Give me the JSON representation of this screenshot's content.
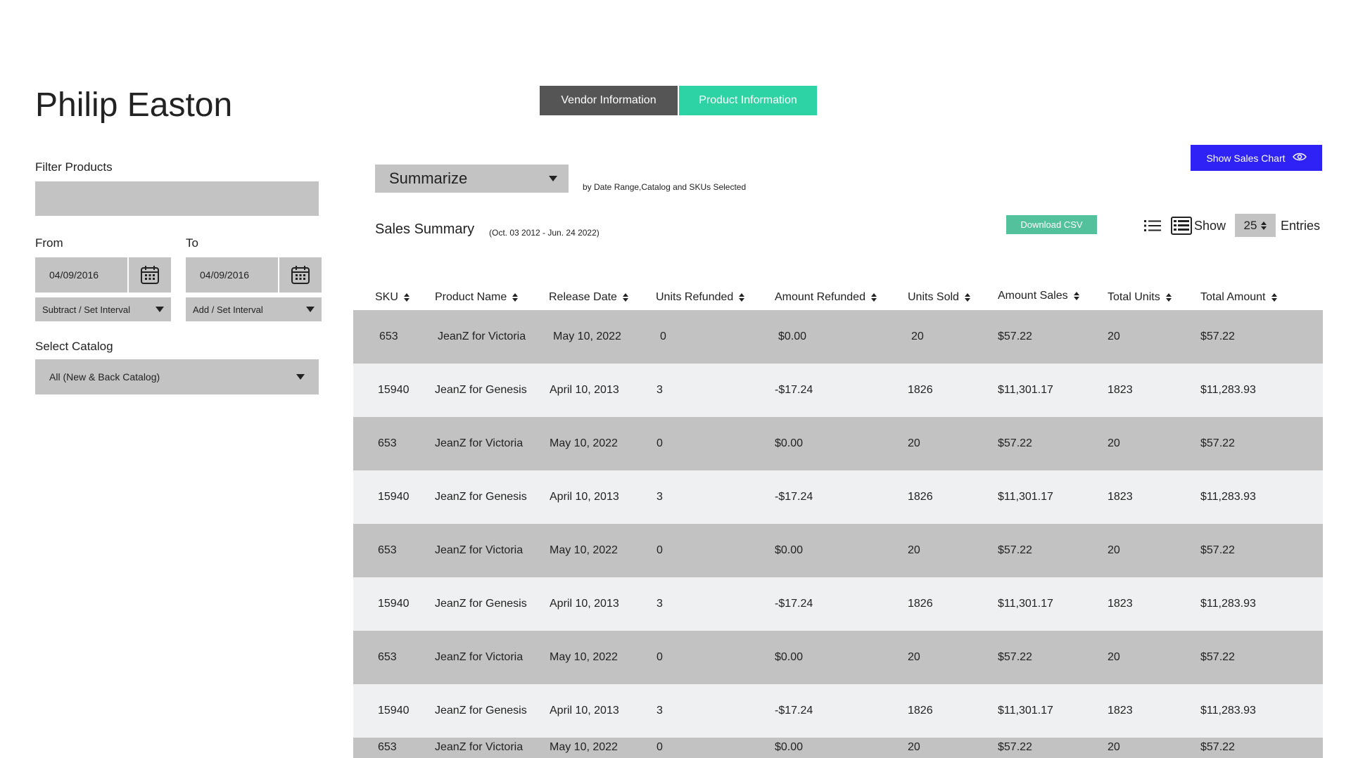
{
  "vendor": {
    "name": "Philip Easton"
  },
  "tabs": [
    {
      "label": "Vendor Information",
      "active": false
    },
    {
      "label": "Product Information",
      "active": true
    }
  ],
  "filter": {
    "label": "Filter Products",
    "value": ""
  },
  "date_range": {
    "from_label": "From",
    "to_label": "To",
    "from_value": "04/09/2016",
    "to_value": "04/09/2016",
    "from_interval": "Subtract / Set Interval",
    "to_interval": "Add / Set Interval"
  },
  "catalog": {
    "label": "Select Catalog",
    "selected": "All (New & Back Catalog)"
  },
  "summarize": {
    "selected": "Summarize",
    "note": "by Date Range,Catalog and SKUs Selected"
  },
  "actions": {
    "show_chart": "Show Sales Chart",
    "download_csv": "Download CSV"
  },
  "summary": {
    "title": "Sales Summary",
    "range": "(Oct. 03 2012 - Jun. 24 2022)"
  },
  "entries": {
    "show_label": "Show",
    "value": "25",
    "entries_label": "Entries"
  },
  "colors": {
    "accent_green": "#2ed3a3",
    "csv_green": "#53c29c",
    "blue": "#2e22f4",
    "dark_tab": "#555555"
  },
  "table": {
    "columns": [
      "SKU",
      "Product Name",
      "Release Date",
      "Units Refunded",
      "Amount Refunded",
      "Units Sold",
      "Amount Sales",
      "Total Units",
      "Total Amount"
    ],
    "rows": [
      [
        "653",
        "JeanZ for Victoria",
        "May 10, 2022",
        "0",
        "$0.00",
        "20",
        "$57.22",
        "20",
        "$57.22"
      ],
      [
        "15940",
        "JeanZ for Genesis",
        "April 10, 2013",
        "3",
        "-$17.24",
        "1826",
        "$11,301.17",
        "1823",
        "$11,283.93"
      ],
      [
        "653",
        "JeanZ for Victoria",
        "May 10, 2022",
        "0",
        "$0.00",
        "20",
        "$57.22",
        "20",
        "$57.22"
      ],
      [
        "15940",
        "JeanZ for Genesis",
        "April 10, 2013",
        "3",
        "-$17.24",
        "1826",
        "$11,301.17",
        "1823",
        "$11,283.93"
      ],
      [
        "653",
        "JeanZ for Victoria",
        "May 10, 2022",
        "0",
        "$0.00",
        "20",
        "$57.22",
        "20",
        "$57.22"
      ],
      [
        "15940",
        "JeanZ for Genesis",
        "April 10, 2013",
        "3",
        "-$17.24",
        "1826",
        "$11,301.17",
        "1823",
        "$11,283.93"
      ],
      [
        "653",
        "JeanZ for Victoria",
        "May 10, 2022",
        "0",
        "$0.00",
        "20",
        "$57.22",
        "20",
        "$57.22"
      ],
      [
        "15940",
        "JeanZ for Genesis",
        "April 10, 2013",
        "3",
        "-$17.24",
        "1826",
        "$11,301.17",
        "1823",
        "$11,283.93"
      ],
      [
        "653",
        "JeanZ for Victoria",
        "May 10, 2022",
        "0",
        "$0.00",
        "20",
        "$57.22",
        "20",
        "$57.22"
      ]
    ]
  }
}
